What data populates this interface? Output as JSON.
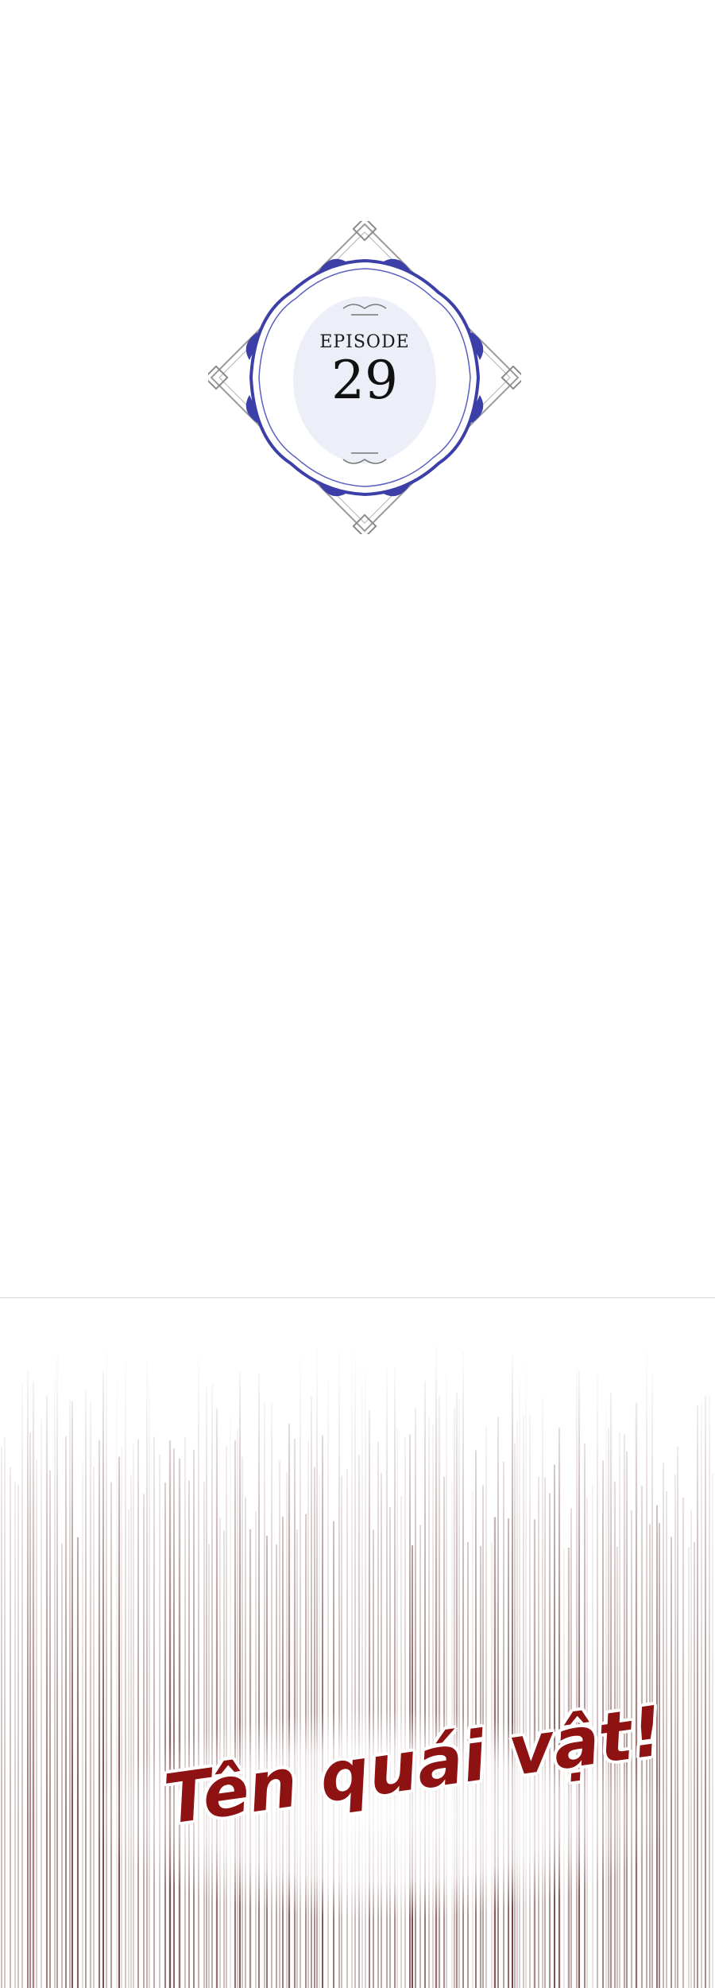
{
  "episode": {
    "label": "EPISODE",
    "number": "29",
    "frame_colors": {
      "primary": "#3d3fa8",
      "secondary": "#8a8a8a",
      "center_wash": "#e6e8f5"
    }
  },
  "panel": {
    "shout_text": "Tên quái vật!",
    "text_color": "#8e1212",
    "line_color": "#6b3a3a"
  }
}
